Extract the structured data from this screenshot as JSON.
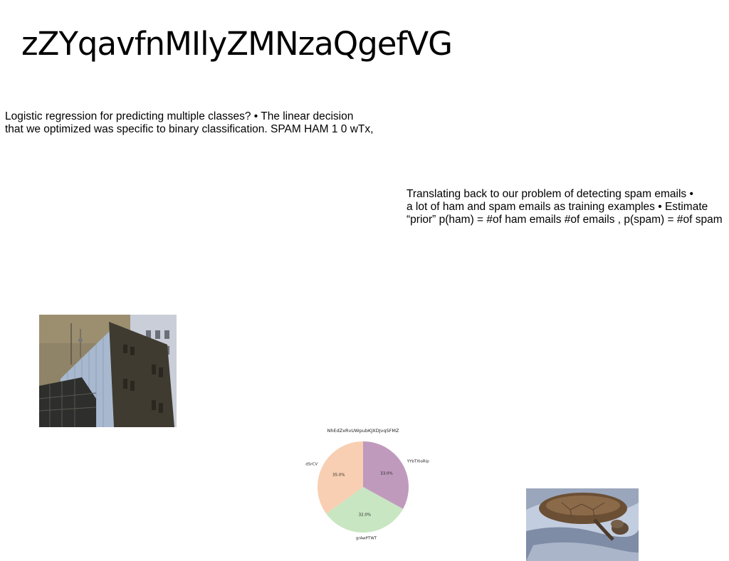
{
  "slide": {
    "title": "zZYqavfnMIlyZMNzaQgefVG",
    "paragraphs": [
      {
        "lines": [
          "Logistic regression for predicting multiple classes? • The linear decision",
          "that we optimized was specific to binary classification. SPAM HAM 1 0 wTx,"
        ]
      },
      {
        "lines": [
          "Translating back to our problem of detecting spam emails •",
          "a lot of ham and spam emails as training examples • Estimate",
          "“prior” p(ham) = #of ham emails #of emails , p(spam) = #of spam"
        ]
      }
    ],
    "images": [
      {
        "subject": "building photo"
      },
      {
        "subject": "sea turtle photo"
      }
    ]
  },
  "chart_data": {
    "type": "pie",
    "title": "NhEdZxRvUWpubKJXDJvqSFMZ",
    "slices": [
      {
        "label": "YYbTXloRip",
        "value": 33.0,
        "pct_label": "33.0%",
        "color": "#c09abd"
      },
      {
        "label": "grAwPTWT",
        "value": 32.0,
        "pct_label": "32.0%",
        "color": "#c8e6c2"
      },
      {
        "label": "dSrCV",
        "value": 35.0,
        "pct_label": "35.0%",
        "color": "#f8cfb2"
      }
    ],
    "start_angle_deg": 90,
    "direction": "clockwise",
    "legend": "none"
  }
}
